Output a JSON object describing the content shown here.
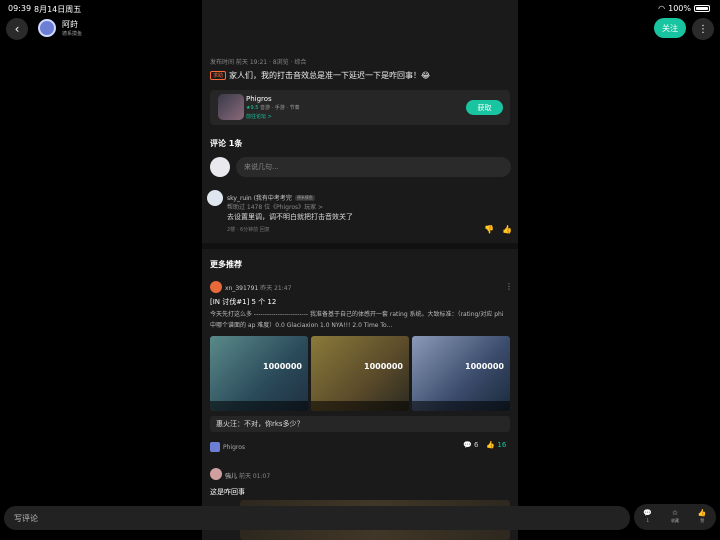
{
  "status_bar": {
    "time": "09:39",
    "date": "8月14日周五",
    "battery": "100%"
  },
  "header": {
    "back_icon": "chevron-left-icon",
    "username": "阿莳",
    "user_sub": "德系摸鱼",
    "follow_label": "关注",
    "more_icon": "more-vertical-icon"
  },
  "post": {
    "meta": "发布时间 前天 19:21 · 8浏览 · 综合",
    "tag": "求助",
    "text": "家人们，我的打击音效总是准一下延迟一下是咋回事！😂"
  },
  "game_card": {
    "name": "Phigros",
    "score": "★9.5",
    "tags": "音游 · 手游 · 节奏",
    "link": "前往论坛 >",
    "get_label": "获取"
  },
  "comments": {
    "heading": "评论 1条",
    "input_placeholder": "来说几句...",
    "items": [
      {
        "user": "sky_ruin (我有中考考完",
        "badge": "德系摸鱼",
        "help": "帮助过 1478 位《Phigros》玩家 >",
        "text": "去设置里调，调不明白就把打击音效关了",
        "foot": "2楼 · 6分钟前  回复"
      }
    ]
  },
  "recommend": {
    "heading": "更多推荐",
    "post1": {
      "user": "xn_391791",
      "time": "昨天 21:47",
      "title": "[IN 讨伐#1] 5 个 12",
      "body": "今天先打这么多  -------------------------  我准备基于自己的体感开一套 rating 系统。大致标准：（rating/对应 phi 中哪个谱面的 ap 难度）0.0 Glaciaxion  1.0 NYA!!!  2.0 Time To...",
      "image_scores": [
        "1000000",
        "1000000",
        "1000000"
      ],
      "reply_preview": "惠火汪：不对，你rks多少？",
      "source": "Phigros",
      "comments_count": "6",
      "likes_count": "16"
    },
    "post2": {
      "user": "強儿",
      "time": "前天 01:07",
      "title": "这是咋回事"
    }
  },
  "bottom_bar": {
    "comment_placeholder": "写评论",
    "comment_count": "1",
    "collect_label": "收藏",
    "like_label": "赞"
  },
  "colors": {
    "accent": "#19c4a0",
    "background": "#000000",
    "panel": "#1a1a1a"
  }
}
